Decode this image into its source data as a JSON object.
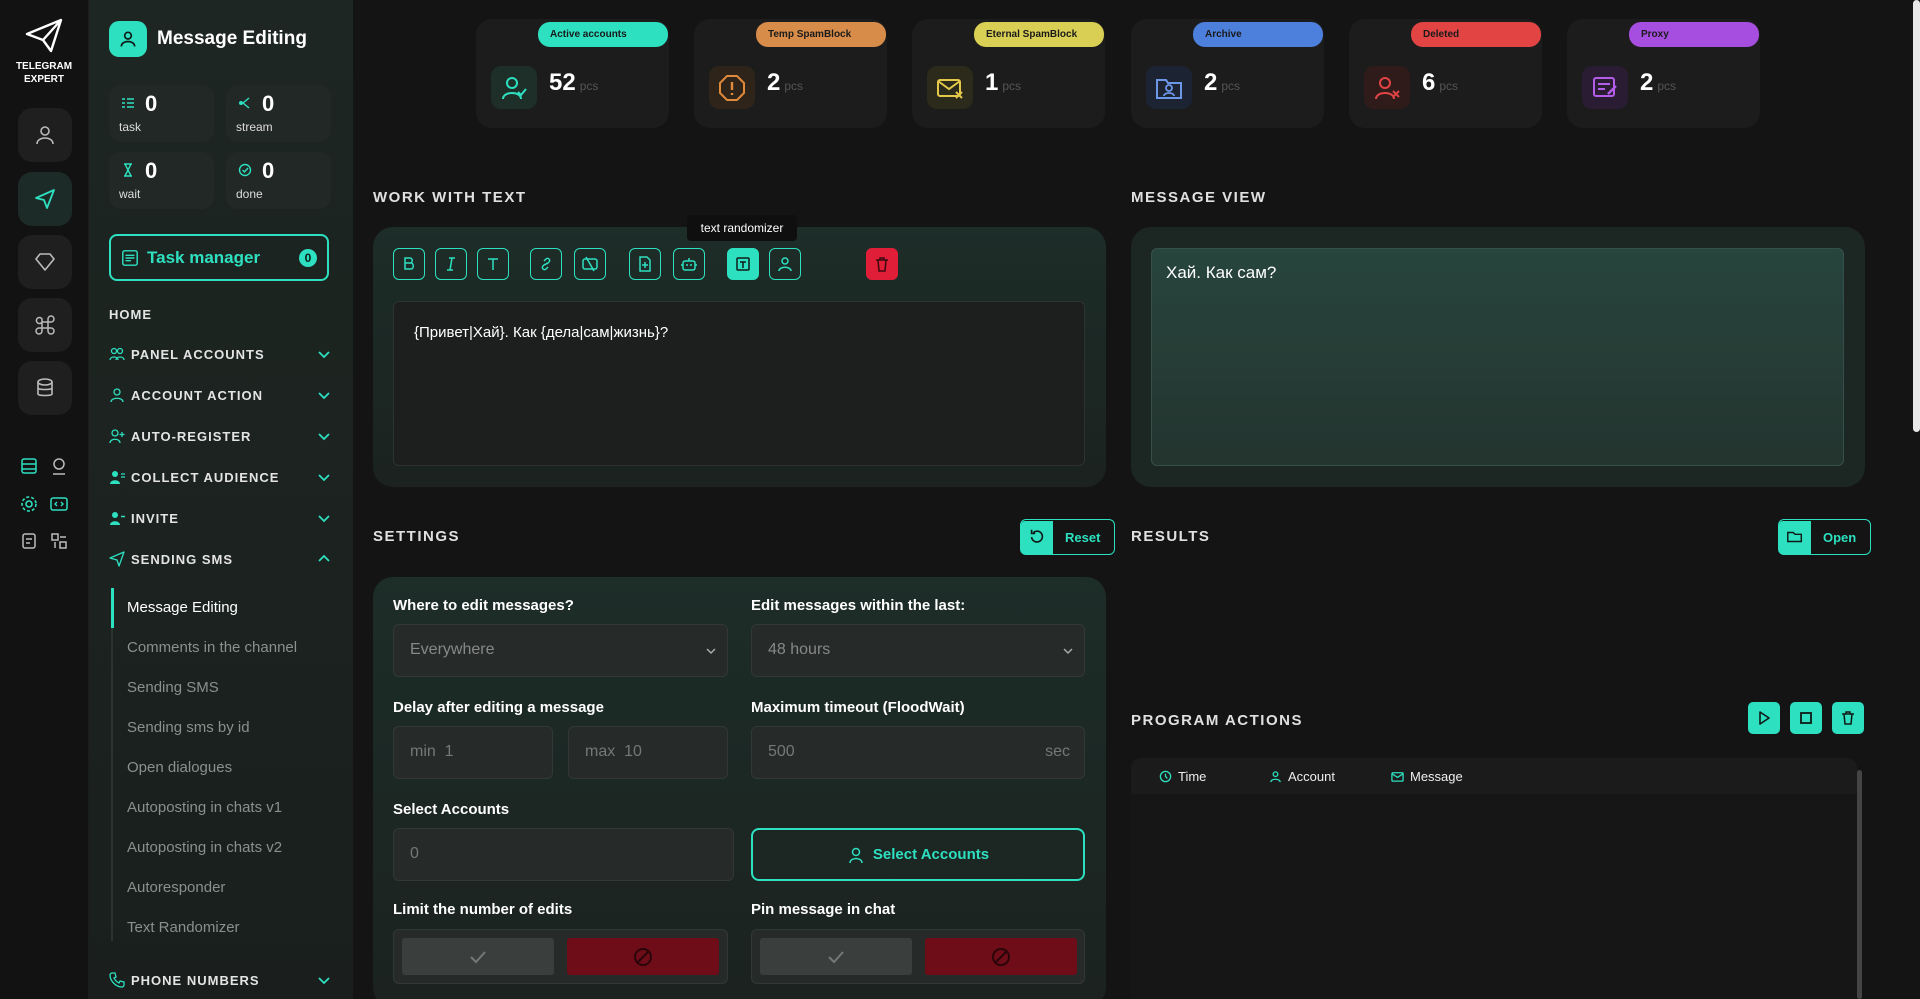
{
  "app": {
    "logo_line1": "TELEGRAM",
    "logo_line2": "EXPERT",
    "accent": "#2de0c0"
  },
  "sidebar": {
    "title": "Message Editing",
    "stats": [
      {
        "value": "0",
        "label": "task",
        "icon": "task-list-icon"
      },
      {
        "value": "0",
        "label": "stream",
        "icon": "stream-icon"
      },
      {
        "value": "0",
        "label": "wait",
        "icon": "hourglass-icon"
      },
      {
        "value": "0",
        "label": "done",
        "icon": "check-circle-icon"
      }
    ],
    "task_manager": {
      "label": "Task manager",
      "count": "0"
    },
    "home": "HOME",
    "sections": [
      {
        "label": "PANEL ACCOUNTS",
        "expanded": false
      },
      {
        "label": "ACCOUNT ACTION",
        "expanded": false
      },
      {
        "label": "AUTO-REGISTER",
        "expanded": false
      },
      {
        "label": "COLLECT AUDIENCE",
        "expanded": false
      },
      {
        "label": "INVITE",
        "expanded": false
      },
      {
        "label": "SENDING SMS",
        "expanded": true
      },
      {
        "label": "PHONE NUMBERS",
        "expanded": false
      }
    ],
    "sms_items": [
      {
        "label": "Message Editing",
        "active": true
      },
      {
        "label": "Comments in the channel"
      },
      {
        "label": "Sending SMS"
      },
      {
        "label": "Sending sms by id"
      },
      {
        "label": "Open dialogues"
      },
      {
        "label": "Autoposting in chats v1"
      },
      {
        "label": "Autoposting in chats v2"
      },
      {
        "label": "Autoresponder"
      },
      {
        "label": "Text Randomizer"
      }
    ]
  },
  "status_cards": [
    {
      "label": "Active accounts",
      "value": "52",
      "unit": "pcs",
      "color": "#2de0c0",
      "icon": "user-check-icon"
    },
    {
      "label": "Temp SpamBlock",
      "value": "2",
      "unit": "pcs",
      "color": "#d78c4a",
      "icon": "warning-icon"
    },
    {
      "label": "Eternal SpamBlock",
      "value": "1",
      "unit": "pcs",
      "color": "#d9cf55",
      "icon": "mail-block-icon"
    },
    {
      "label": "Archive",
      "value": "2",
      "unit": "pcs",
      "color": "#4d7fdc",
      "icon": "archive-folder-icon"
    },
    {
      "label": "Deleted",
      "value": "6",
      "unit": "pcs",
      "color": "#e24444",
      "icon": "user-delete-icon"
    },
    {
      "label": "Proxy",
      "value": "2",
      "unit": "pcs",
      "color": "#a64ee0",
      "icon": "proxy-icon"
    }
  ],
  "work_with_text": {
    "title": "WORK WITH TEXT",
    "tooltip": "text randomizer",
    "text": "{Привет|Хай}. Как {дела|сам|жизнь}?"
  },
  "message_view": {
    "title": "MESSAGE VIEW",
    "text": "Хай. Как сам?"
  },
  "settings": {
    "title": "SETTINGS",
    "reset_label": "Reset",
    "where_label": "Where to edit messages?",
    "where_value": "Everywhere",
    "within_label": "Edit messages within the last:",
    "within_value": "48 hours",
    "delay_label": "Delay after editing a message",
    "delay_min_prefix": "min",
    "delay_min": "1",
    "delay_max_prefix": "max",
    "delay_max": "10",
    "timeout_label": "Maximum timeout (FloodWait)",
    "timeout_value": "500",
    "timeout_unit": "sec",
    "select_accounts_label": "Select Accounts",
    "select_accounts_value": "0",
    "select_accounts_button": "Select Accounts",
    "limit_label": "Limit the number of edits",
    "pin_label": "Pin message in chat"
  },
  "results": {
    "title": "RESULTS",
    "open_label": "Open"
  },
  "program_actions": {
    "title": "PROGRAM ACTIONS",
    "columns": [
      "Time",
      "Account",
      "Message"
    ]
  }
}
